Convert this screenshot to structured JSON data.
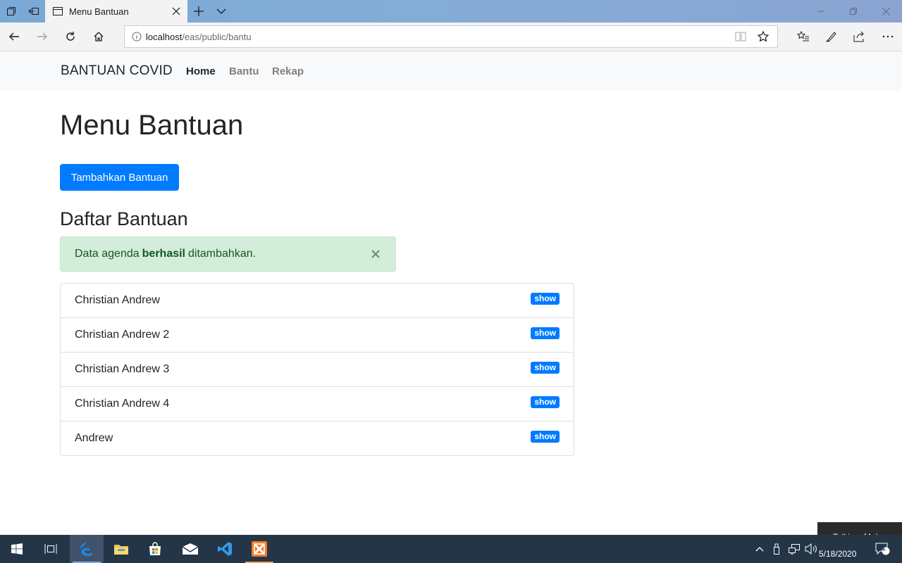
{
  "browser": {
    "tab_title": "Menu Bantuan",
    "url_host": "localhost",
    "url_path": "/eas/public/bantu"
  },
  "navbar": {
    "brand": "BANTUAN COVID",
    "links": [
      {
        "label": "Home",
        "active": true
      },
      {
        "label": "Bantu",
        "active": false
      },
      {
        "label": "Rekap",
        "active": false
      }
    ]
  },
  "main": {
    "title": "Menu Bantuan",
    "add_button": "Tambahkan Bantuan",
    "section_title": "Daftar Bantuan",
    "alert": {
      "before": "Data agenda",
      "bold": "berhasil",
      "after": "ditambahkan.",
      "close_symbol": "×"
    },
    "items": [
      {
        "name": "Christian Andrew",
        "badge": "show"
      },
      {
        "name": "Christian Andrew 2",
        "badge": "show"
      },
      {
        "name": "Christian Andrew 3",
        "badge": "show"
      },
      {
        "name": "Christian Andrew 4",
        "badge": "show"
      },
      {
        "name": "Andrew",
        "badge": "show"
      }
    ]
  },
  "taskbar": {
    "toast": "Talking: Muhamm",
    "date": "5/18/2020",
    "notification_count": "1"
  },
  "colors": {
    "primary": "#007bff",
    "alert_bg": "#d4edda",
    "alert_text": "#155724",
    "taskbar": "#243548"
  }
}
